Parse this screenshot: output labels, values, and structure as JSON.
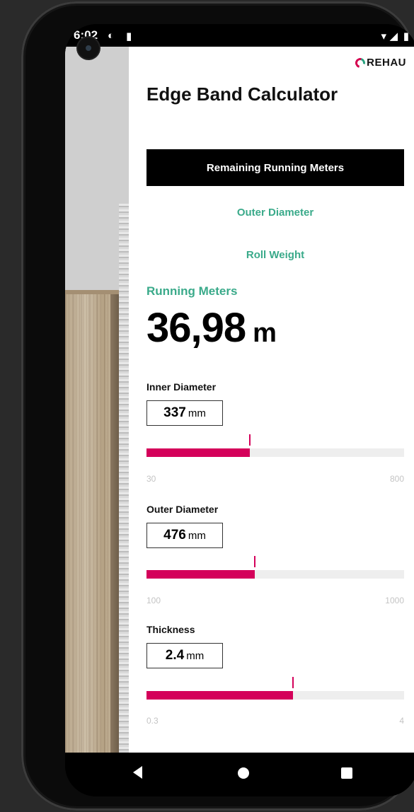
{
  "status_bar": {
    "time": "6:02"
  },
  "brand": {
    "name": "REHAU",
    "primary_color": "#d4005a",
    "accent_color": "#3aaa8a"
  },
  "app": {
    "title": "Edge Band Calculator"
  },
  "tabs": [
    {
      "label": "Remaining Running Meters",
      "active": true
    },
    {
      "label": "Outer Diameter",
      "active": false
    },
    {
      "label": "Roll Weight",
      "active": false
    }
  ],
  "result": {
    "label": "Running Meters",
    "value": "36,98",
    "unit": "m"
  },
  "params": [
    {
      "label": "Inner Diameter",
      "value": "337",
      "unit": "mm",
      "min": "30",
      "max": "800",
      "fraction": 0.4
    },
    {
      "label": "Outer Diameter",
      "value": "476",
      "unit": "mm",
      "min": "100",
      "max": "1000",
      "fraction": 0.42
    },
    {
      "label": "Thickness",
      "value": "2.4",
      "unit": "mm",
      "min": "0.3",
      "max": "4",
      "fraction": 0.57
    }
  ],
  "navbar": {
    "icons": [
      "back-icon",
      "home-icon",
      "recents-icon"
    ]
  }
}
